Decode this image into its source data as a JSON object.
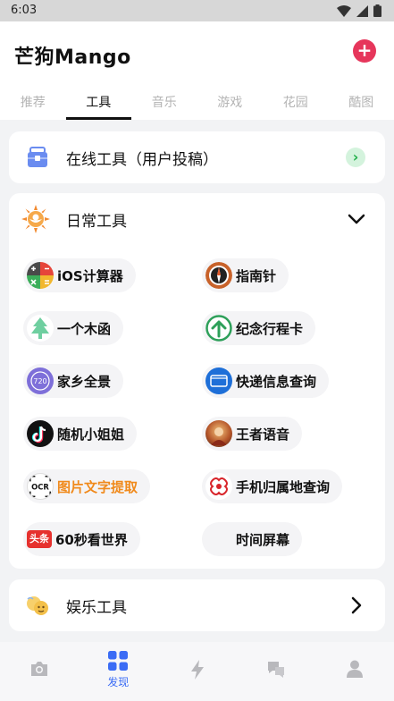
{
  "status_bar": {
    "time": "6:03"
  },
  "header": {
    "logo": "芒狗Mango",
    "add_symbol": "+"
  },
  "tabs": [
    {
      "label": "推荐",
      "active": false
    },
    {
      "label": "工具",
      "active": true
    },
    {
      "label": "音乐",
      "active": false
    },
    {
      "label": "游戏",
      "active": false
    },
    {
      "label": "花园",
      "active": false
    },
    {
      "label": "酷图",
      "active": false
    }
  ],
  "online_tools": {
    "title": "在线工具（用户投稿）",
    "icon": "toolbox-icon"
  },
  "daily_tools": {
    "title": "日常工具",
    "icon": "sun-icon",
    "items": [
      {
        "label": "iOS计算器",
        "icon": "calculator-icon"
      },
      {
        "label": "指南针",
        "icon": "compass-icon"
      },
      {
        "label": "一个木函",
        "icon": "tree-icon"
      },
      {
        "label": "纪念行程卡",
        "icon": "arrow-up-icon"
      },
      {
        "label": "家乡全景",
        "icon": "panorama-720-icon",
        "badge": "720"
      },
      {
        "label": "快递信息查询",
        "icon": "express-icon"
      },
      {
        "label": "随机小姐姐",
        "icon": "tiktok-icon"
      },
      {
        "label": "王者语音",
        "icon": "game-avatar-icon"
      },
      {
        "label": "图片文字提取",
        "icon": "ocr-icon",
        "badge": "OCR",
        "highlight": true
      },
      {
        "label": "手机归属地查询",
        "icon": "china-unicom-icon"
      },
      {
        "label": "60秒看世界",
        "icon": "toutiao-icon",
        "badge": "头条"
      },
      {
        "label": "时间屏幕",
        "icon": "clock-icon"
      }
    ]
  },
  "fun_tools": {
    "title": "娱乐工具",
    "icon": "emoji-icon"
  },
  "bottom_nav": [
    {
      "label": "",
      "icon": "camera-icon"
    },
    {
      "label": "发现",
      "icon": "grid-icon",
      "active": true
    },
    {
      "label": "",
      "icon": "lightning-icon"
    },
    {
      "label": "",
      "icon": "chat-icon"
    },
    {
      "label": "",
      "icon": "user-icon"
    }
  ],
  "colors": {
    "accent_blue": "#3b6cf5",
    "add_pink": "#e6365b",
    "highlight_orange": "#f08a1c",
    "go_green": "#22b04b"
  }
}
